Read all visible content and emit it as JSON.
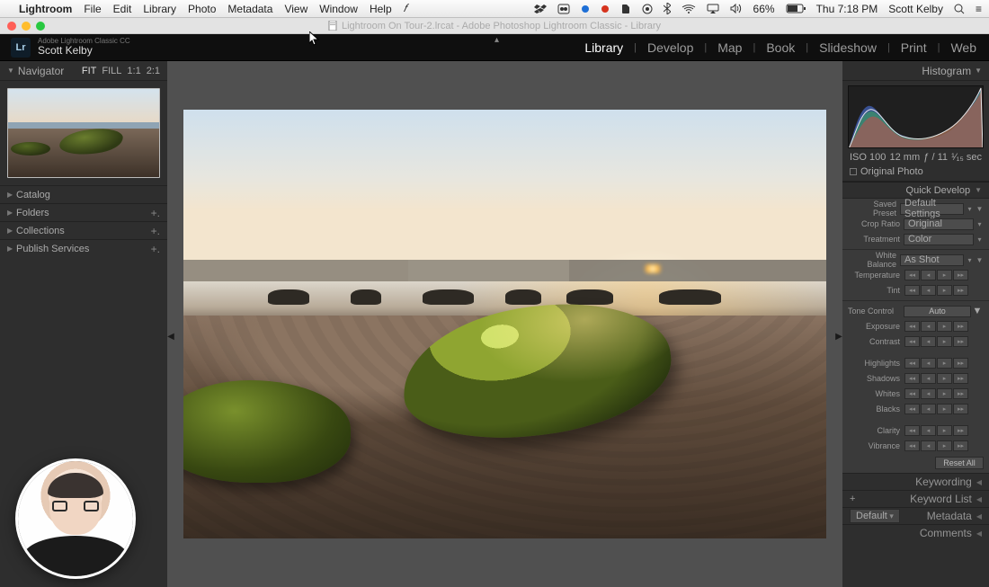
{
  "mac": {
    "app": "Lightroom",
    "menus": [
      "File",
      "Edit",
      "Library",
      "Photo",
      "Metadata",
      "View",
      "Window",
      "Help"
    ],
    "battery": "66%",
    "clock": "Thu 7:18 PM",
    "user": "Scott Kelby"
  },
  "window": {
    "title": "Lightroom On Tour-2.lrcat - Adobe Photoshop Lightroom Classic - Library"
  },
  "header": {
    "product": "Adobe Lightroom Classic CC",
    "user": "Scott Kelby",
    "modules": [
      "Library",
      "Develop",
      "Map",
      "Book",
      "Slideshow",
      "Print",
      "Web"
    ],
    "active_module": "Library"
  },
  "left": {
    "navigator": {
      "label": "Navigator",
      "zoom": [
        "FIT",
        "FILL",
        "1:1",
        "2:1"
      ],
      "zoom_active": "FIT"
    },
    "sections": [
      {
        "label": "Catalog",
        "plus": false
      },
      {
        "label": "Folders",
        "plus": true
      },
      {
        "label": "Collections",
        "plus": true
      },
      {
        "label": "Publish Services",
        "plus": true
      }
    ]
  },
  "right": {
    "histogram": {
      "label": "Histogram",
      "iso": "ISO 100",
      "focal": "12 mm",
      "aperture": "ƒ / 11",
      "shutter": "¹⁄₁₅ sec",
      "original_photo": "Original Photo"
    },
    "quick_develop": {
      "title": "Quick Develop",
      "saved_preset": {
        "label": "Saved Preset",
        "value": "Default Settings"
      },
      "crop_ratio": {
        "label": "Crop Ratio",
        "value": "Original"
      },
      "treatment": {
        "label": "Treatment",
        "value": "Color"
      },
      "white_balance": {
        "label": "White Balance",
        "value": "As Shot"
      },
      "wb_sliders": [
        "Temperature",
        "Tint"
      ],
      "tone": {
        "label": "Tone Control",
        "button": "Auto"
      },
      "tone_sliders": [
        "Exposure",
        "Contrast",
        "Highlights",
        "Shadows",
        "Whites",
        "Blacks",
        "Clarity",
        "Vibrance"
      ],
      "reset": "Reset All"
    },
    "panels": [
      {
        "label": "Keywording"
      },
      {
        "label": "Keyword List",
        "plus": true
      },
      {
        "label": "Metadata",
        "preset": "Default"
      },
      {
        "label": "Comments"
      }
    ]
  }
}
